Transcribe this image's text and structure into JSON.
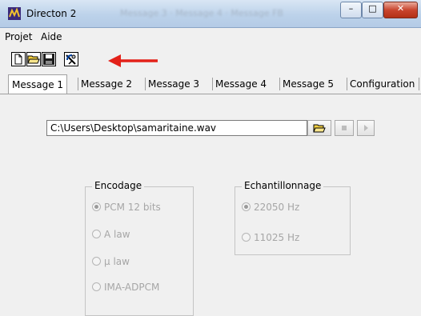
{
  "window": {
    "title": "Directon 2",
    "background_ghost_text": "Message 3 · Message 4 · Message FB",
    "controls": {
      "minimize": "–",
      "maximize": "□",
      "close": "✕"
    }
  },
  "menu": {
    "items": [
      {
        "label": "Projet"
      },
      {
        "label": "Aide"
      }
    ]
  },
  "toolbar": {
    "buttons": [
      "new-file-icon",
      "open-folder-icon",
      "save-disk-icon",
      "satellite-dish-icon"
    ],
    "annotation_color": "#e32119"
  },
  "tabs": [
    {
      "label": "Message 1",
      "active": true
    },
    {
      "label": "Message 2",
      "active": false
    },
    {
      "label": "Message 3",
      "active": false
    },
    {
      "label": "Message 4",
      "active": false
    },
    {
      "label": "Message 5",
      "active": false
    },
    {
      "label": "Configuration",
      "active": false
    }
  ],
  "file": {
    "path": "C:\\Users\\Desktop\\samaritaine.wav",
    "buttons": [
      "open-folder-icon",
      "stop-icon",
      "play-icon"
    ]
  },
  "encodage": {
    "title": "Encodage",
    "options": [
      {
        "label": "PCM 12 bits",
        "selected": true
      },
      {
        "label": "A law",
        "selected": false
      },
      {
        "label": "µ law",
        "selected": false
      },
      {
        "label": "IMA-ADPCM",
        "selected": false
      }
    ]
  },
  "echantillonnage": {
    "title": "Echantillonnage",
    "options": [
      {
        "label": "22050 Hz",
        "selected": true
      },
      {
        "label": "11025 Hz",
        "selected": false
      }
    ]
  }
}
